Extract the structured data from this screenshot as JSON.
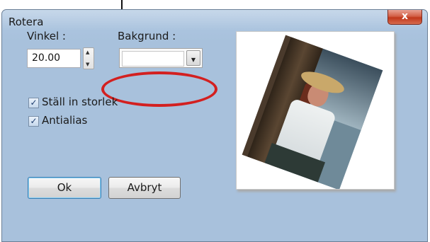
{
  "window": {
    "title": "Rotera",
    "close_symbol": "x"
  },
  "angle": {
    "label": "Vinkel :",
    "value": "20.00"
  },
  "background": {
    "label": "Bakgrund :",
    "value": ""
  },
  "options": [
    {
      "label": "Ställ in storlek",
      "checked": true
    },
    {
      "label": "Antialias",
      "checked": true
    }
  ],
  "buttons": {
    "ok": "Ok",
    "cancel": "Avbryt"
  },
  "colors": {
    "highlight": "#d32020",
    "close": "#c1371b"
  }
}
